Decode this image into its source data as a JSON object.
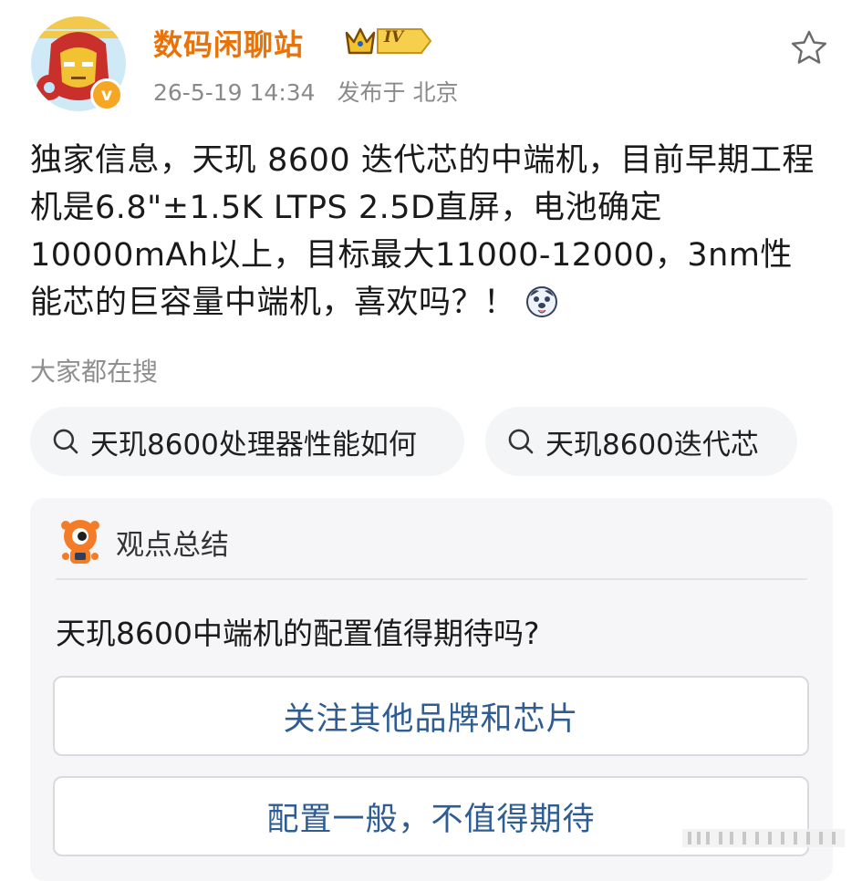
{
  "post": {
    "author": {
      "name": "数码闲聊站",
      "level": "IV",
      "verified_mark": "v"
    },
    "time": "26-5-19 14:34",
    "location": "发布于 北京",
    "content": "独家信息，天玑 8600 迭代芯的中端机，目前早期工程机是6.8\"±1.5K LTPS 2.5D直屏，电池确定10000mAh以上，目标最大11000-12000，3nm性能芯的巨容量中端机，喜欢吗？！",
    "content_emoji": "doge-emoji"
  },
  "search": {
    "title": "大家都在搜",
    "chips": [
      "天玑8600处理器性能如何",
      "天玑8600迭代芯"
    ]
  },
  "summary": {
    "title": "观点总结",
    "question": "天玑8600中端机的配置值得期待吗?",
    "options": [
      "关注其他品牌和芯片",
      "配置一般，不值得期待"
    ]
  },
  "colors": {
    "author": "#e8730a",
    "meta": "#8a8a8a",
    "option_text": "#2f5d93",
    "card_bg": "#f6f6f8",
    "chip_bg": "#f4f5f7"
  }
}
